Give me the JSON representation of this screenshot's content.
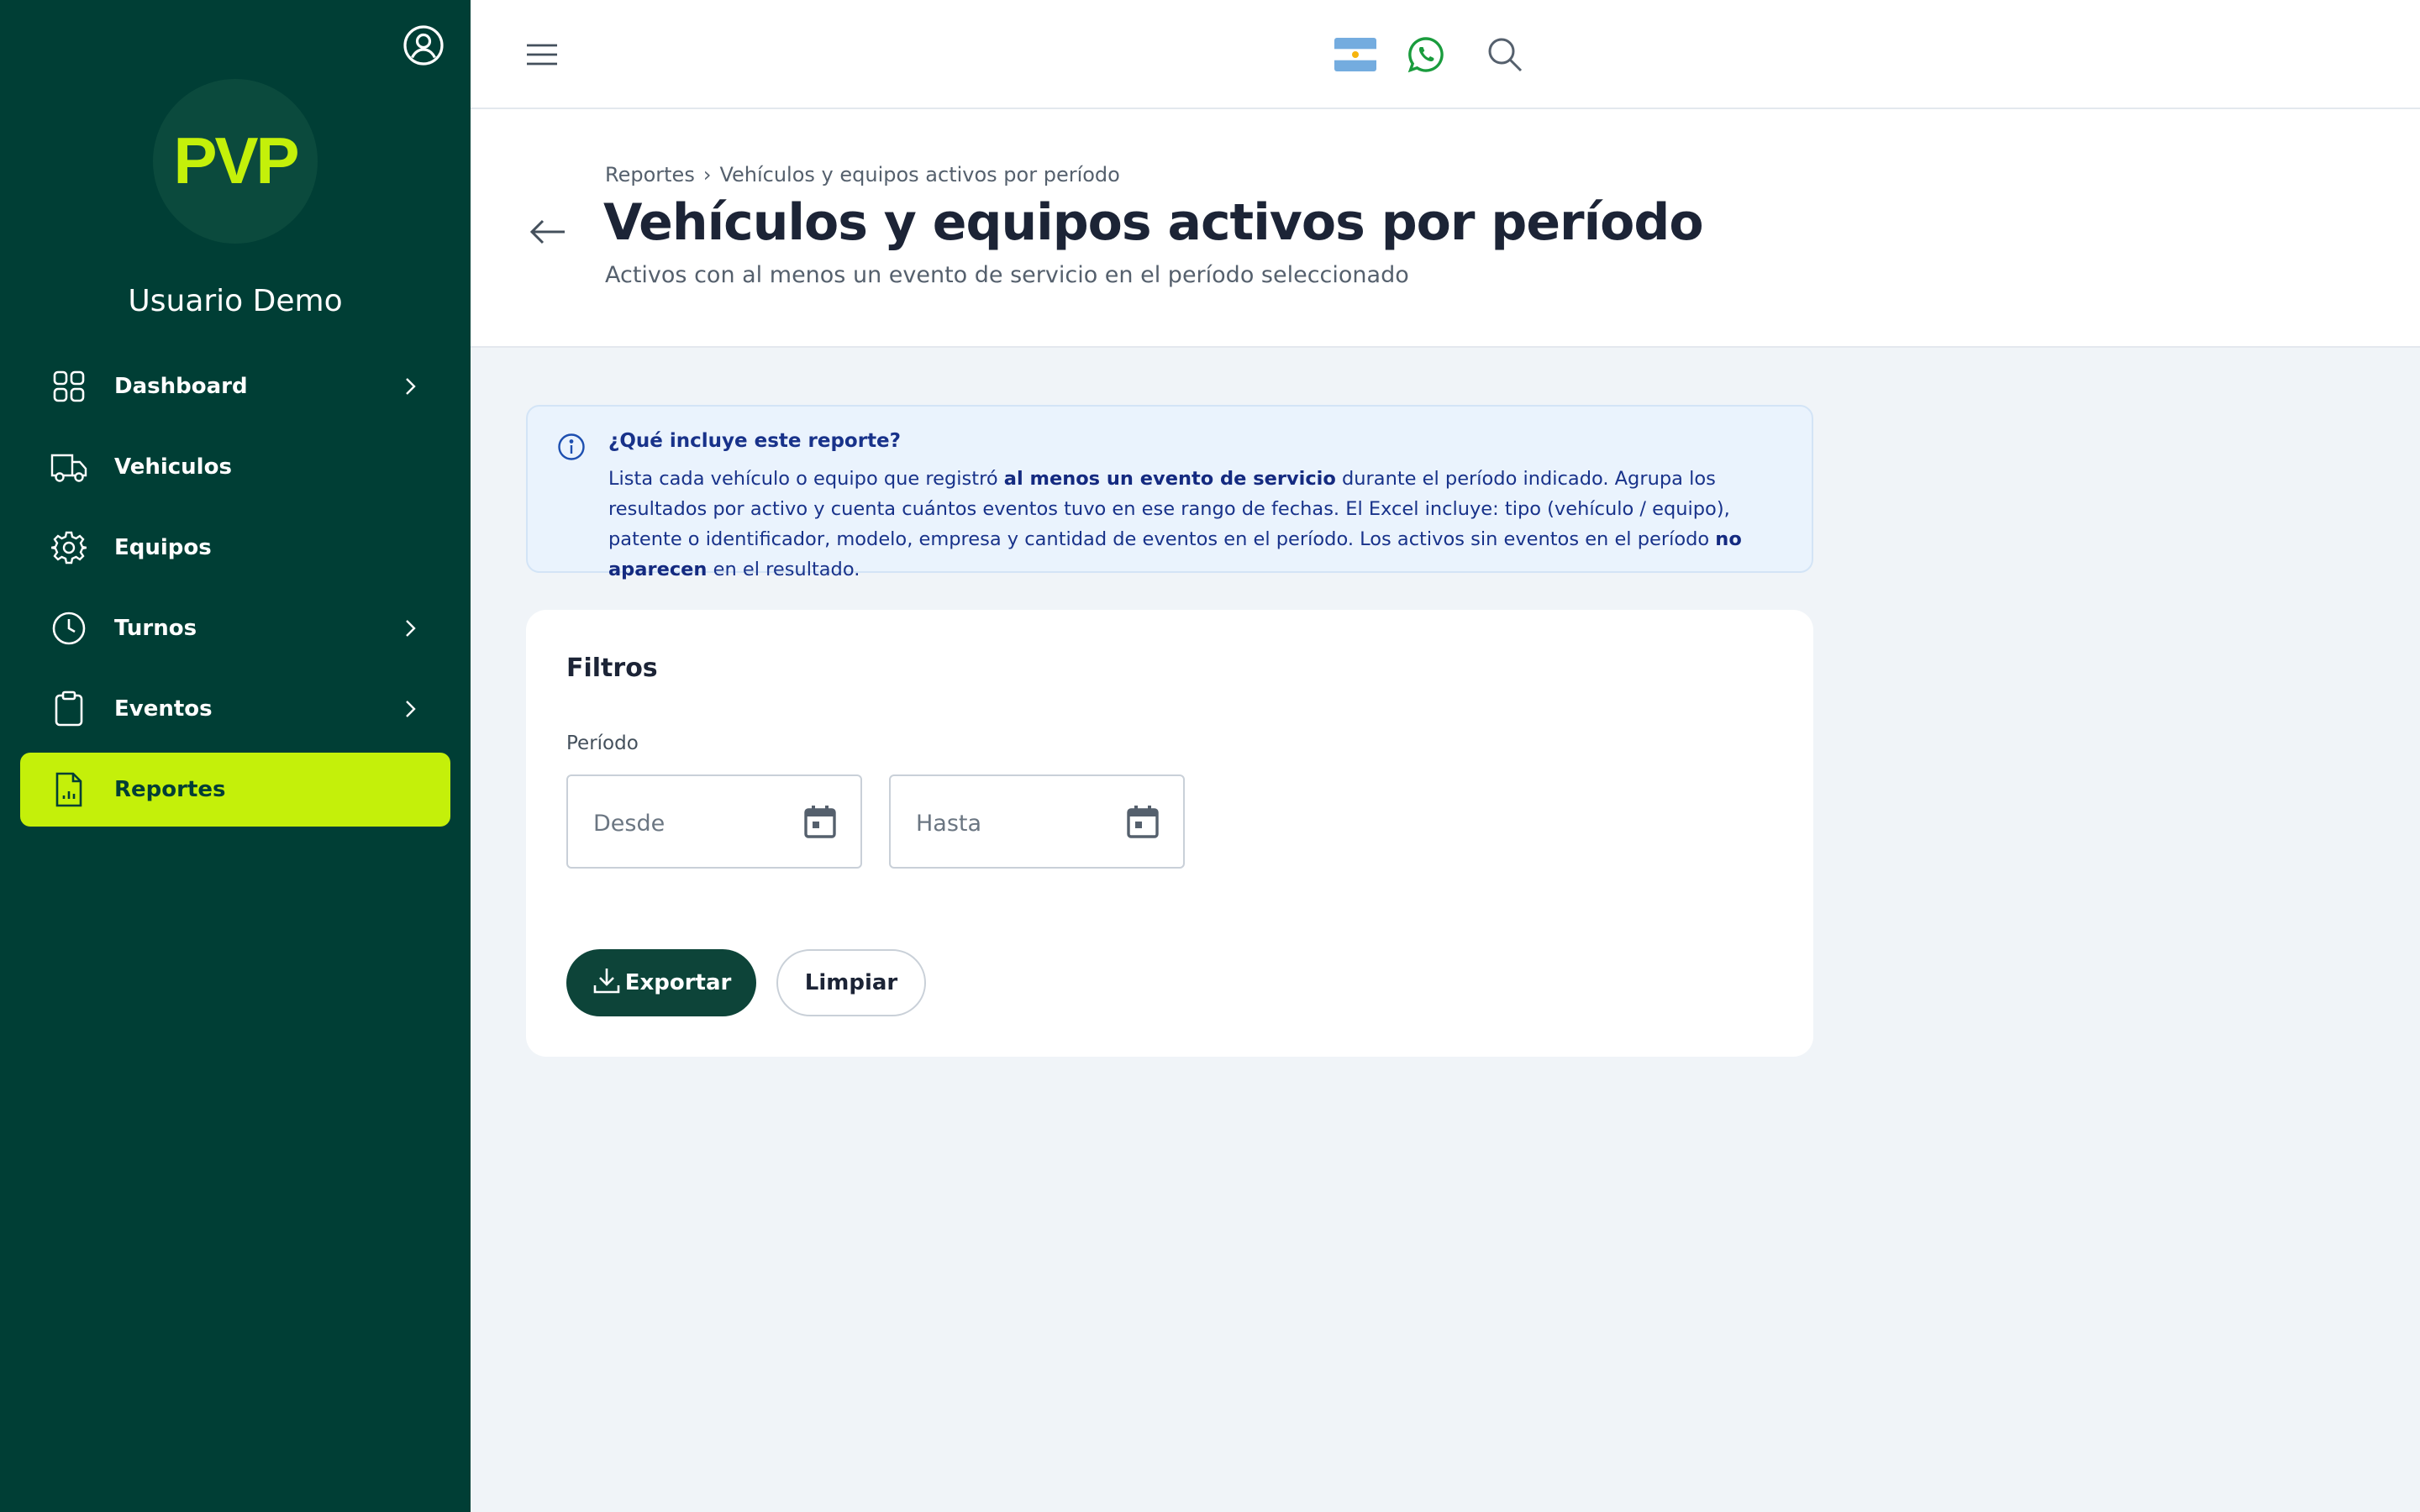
{
  "colors": {
    "sidebar_bg": "#003e35",
    "accent": "#c4f00a",
    "primary_button": "#0d4439",
    "info_bg": "#eaf3fd",
    "info_text": "#18328a",
    "page_bg": "#f0f4f8"
  },
  "sidebar": {
    "profile_icon": "user-circle-icon",
    "logo_text": "PVP",
    "user_name": "Usuario Demo",
    "items": [
      {
        "label": "Dashboard",
        "icon": "grid-icon",
        "has_chevron": true,
        "active": false
      },
      {
        "label": "Vehiculos",
        "icon": "truck-icon",
        "has_chevron": false,
        "active": false
      },
      {
        "label": "Equipos",
        "icon": "gear-icon",
        "has_chevron": false,
        "active": false
      },
      {
        "label": "Turnos",
        "icon": "clock-icon",
        "has_chevron": true,
        "active": false
      },
      {
        "label": "Eventos",
        "icon": "clipboard-icon",
        "has_chevron": true,
        "active": false
      },
      {
        "label": "Reportes",
        "icon": "report-icon",
        "has_chevron": false,
        "active": true
      }
    ]
  },
  "topbar": {
    "menu_icon": "hamburger-icon",
    "flag_icon": "argentina-flag-icon",
    "whatsapp_icon": "whatsapp-icon",
    "search_icon": "search-icon"
  },
  "header": {
    "breadcrumb": {
      "parent": "Reportes",
      "separator": "›",
      "current": "Vehículos y equipos activos por período"
    },
    "title": "Vehículos y equipos activos por período",
    "subtitle": "Activos con al menos un evento de servicio en el período seleccionado"
  },
  "info": {
    "title": "¿Qué incluye este reporte?",
    "text_1": "Lista cada vehículo o equipo que registró ",
    "bold_1": "al menos un evento de servicio",
    "text_2": " durante el período indicado. Agrupa los resultados por activo y cuenta cuántos eventos tuvo en ese rango de fechas. El Excel incluye: tipo (vehículo / equipo), patente o identificador, modelo, empresa y cantidad de eventos en el período. Los activos sin eventos en el período ",
    "bold_2": "no aparecen",
    "text_3": " en el resultado."
  },
  "filters": {
    "title": "Filtros",
    "period_label": "Período",
    "desde": {
      "value": "",
      "placeholder": "Desde"
    },
    "hasta": {
      "value": "",
      "placeholder": "Hasta"
    },
    "export_label": "Exportar",
    "clear_label": "Limpiar"
  }
}
